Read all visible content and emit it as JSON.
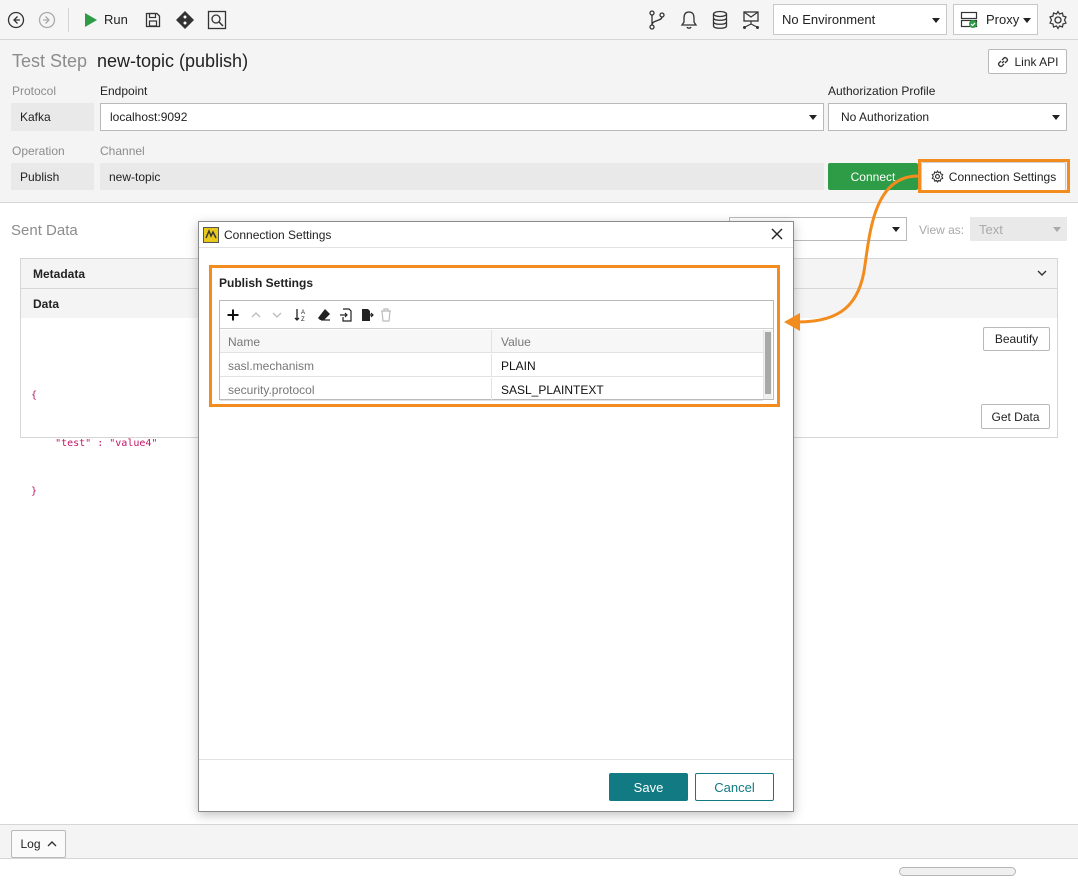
{
  "toolbar": {
    "run_label": "Run",
    "environment": "No Environment",
    "proxy": "Proxy"
  },
  "header": {
    "title_prefix": "Test Step",
    "title": "new-topic (publish)",
    "link_api": "Link API",
    "protocol_label": "Protocol",
    "protocol_value": "Kafka",
    "endpoint_label": "Endpoint",
    "endpoint_value": "localhost:9092",
    "auth_label": "Authorization Profile",
    "auth_value": "No Authorization",
    "operation_label": "Operation",
    "operation_value": "Publish",
    "channel_label": "Channel",
    "channel_value": "new-topic",
    "connect_label": "Connect",
    "connection_settings_label": "Connection Settings"
  },
  "main": {
    "sent_data_title": "Sent Data",
    "view_as_label": "View as:",
    "view_as_value": "Text",
    "metadata_label": "Metadata",
    "data_label": "Data",
    "code_lines": [
      "{",
      "    \"test\" : \"value4\"",
      "}"
    ],
    "beautify_label": "Beautify",
    "get_data_label": "Get Data"
  },
  "dialog": {
    "title": "Connection Settings",
    "section_title": "Publish Settings",
    "columns": [
      "Name",
      "Value"
    ],
    "rows": [
      {
        "name": "sasl.mechanism",
        "value": "PLAIN"
      },
      {
        "name": "security.protocol",
        "value": "SASL_PLAINTEXT"
      }
    ],
    "save_label": "Save",
    "cancel_label": "Cancel"
  },
  "bottom": {
    "log_label": "Log"
  },
  "colors": {
    "accent_orange": "#f28c1e",
    "connect_green": "#2e9c46",
    "save_teal": "#127a83",
    "json_key_color": "#c21566"
  },
  "icons": [
    "back-icon",
    "forward-icon",
    "run-icon",
    "save-icon",
    "git-icon",
    "inspect-icon",
    "branch-icon",
    "bell-icon",
    "database-icon",
    "mail-network-icon",
    "proxy-icon",
    "gear-icon",
    "link-icon",
    "settings-gear-icon",
    "close-icon",
    "app-icon",
    "add-icon",
    "move-up-icon",
    "move-down-icon",
    "sort-icon",
    "eraser-icon",
    "import-icon",
    "export-icon",
    "trash-icon",
    "chevron-down-icon",
    "chevron-up-icon"
  ]
}
